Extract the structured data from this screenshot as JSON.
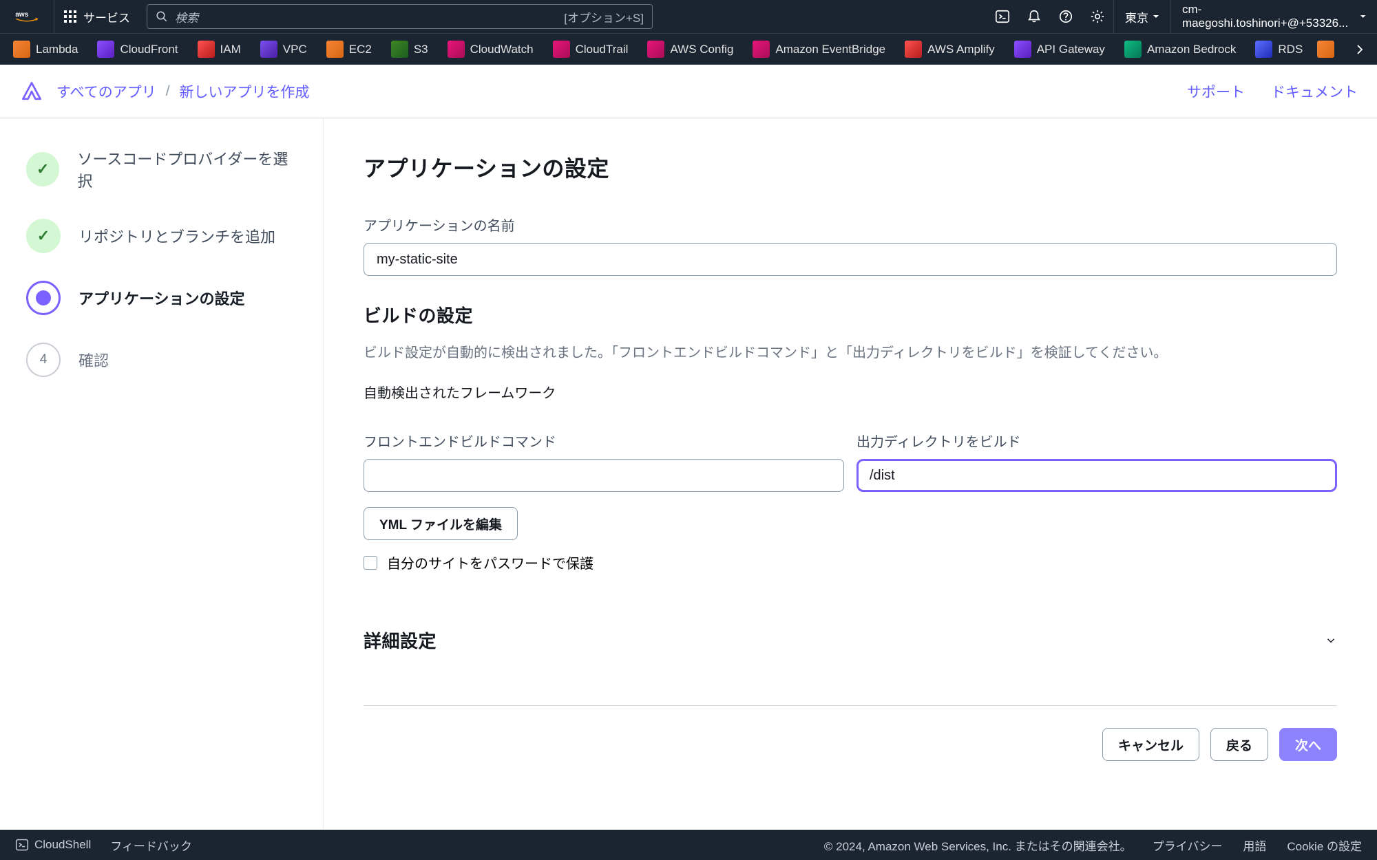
{
  "top_nav": {
    "services_label": "サービス",
    "search_placeholder": "検索",
    "search_shortcut": "[オプション+S]",
    "region": "東京",
    "account": "cm-maegoshi.toshinori+@+53326..."
  },
  "service_bar": {
    "items": [
      "Lambda",
      "CloudFront",
      "IAM",
      "VPC",
      "EC2",
      "S3",
      "CloudWatch",
      "CloudTrail",
      "AWS Config",
      "Amazon EventBridge",
      "AWS Amplify",
      "API Gateway",
      "Amazon Bedrock",
      "RDS"
    ]
  },
  "breadcrumb": {
    "root": "すべてのアプリ",
    "current": "新しいアプリを作成",
    "support": "サポート",
    "docs": "ドキュメント"
  },
  "stepper": {
    "step1": "ソースコードプロバイダーを選択",
    "step2": "リポジトリとブランチを追加",
    "step3": "アプリケーションの設定",
    "step4": "確認",
    "step4_num": "4"
  },
  "page": {
    "heading": "アプリケーションの設定",
    "app_name_label": "アプリケーションの名前",
    "app_name_value": "my-static-site",
    "build_heading": "ビルドの設定",
    "build_desc": "ビルド設定が自動的に検出されました。「フロントエンドビルドコマンド」と「出力ディレクトリをビルド」を検証してください。",
    "framework_label": "自動検出されたフレームワーク",
    "build_cmd_label": "フロントエンドビルドコマンド",
    "build_cmd_value": "",
    "output_dir_label": "出力ディレクトリをビルド",
    "output_dir_value": "/dist",
    "edit_yml_button": "YML ファイルを編集",
    "password_protect_label": "自分のサイトをパスワードで保護",
    "advanced_heading": "詳細設定",
    "cancel_button": "キャンセル",
    "back_button": "戻る",
    "next_button": "次へ"
  },
  "footer": {
    "cloudshell": "CloudShell",
    "feedback": "フィードバック",
    "copyright": "© 2024, Amazon Web Services, Inc. またはその関連会社。",
    "privacy": "プライバシー",
    "terms": "用語",
    "cookie": "Cookie の設定"
  }
}
